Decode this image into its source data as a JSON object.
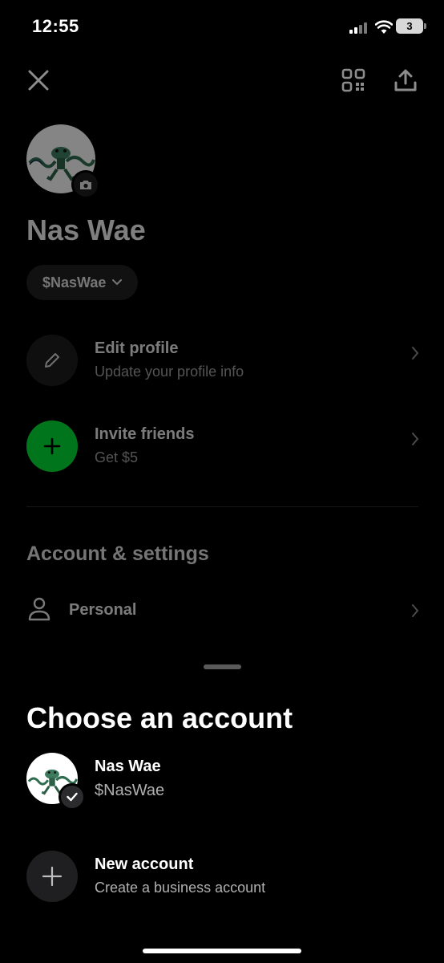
{
  "status_bar": {
    "time": "12:55",
    "battery": "3"
  },
  "header": {
    "close_icon": "close-icon",
    "qr_icon": "qr-code-icon",
    "share_icon": "share-icon"
  },
  "profile": {
    "name": "Nas Wae",
    "cashtag": "$NasWae"
  },
  "actions": [
    {
      "title": "Edit profile",
      "subtitle": "Update your profile info",
      "icon": "pencil-icon"
    },
    {
      "title": "Invite friends",
      "subtitle": "Get $5",
      "icon": "plus-icon",
      "color": "#00d632"
    }
  ],
  "settings": {
    "heading": "Account & settings",
    "personal_label": "Personal"
  },
  "sheet": {
    "title": "Choose an account",
    "accounts": [
      {
        "name": "Nas Wae",
        "cashtag": "$NasWae",
        "selected": true
      }
    ],
    "new_account": {
      "title": "New account",
      "subtitle": "Create a business account"
    }
  },
  "colors": {
    "accent_green": "#00d632",
    "background": "#000000"
  }
}
